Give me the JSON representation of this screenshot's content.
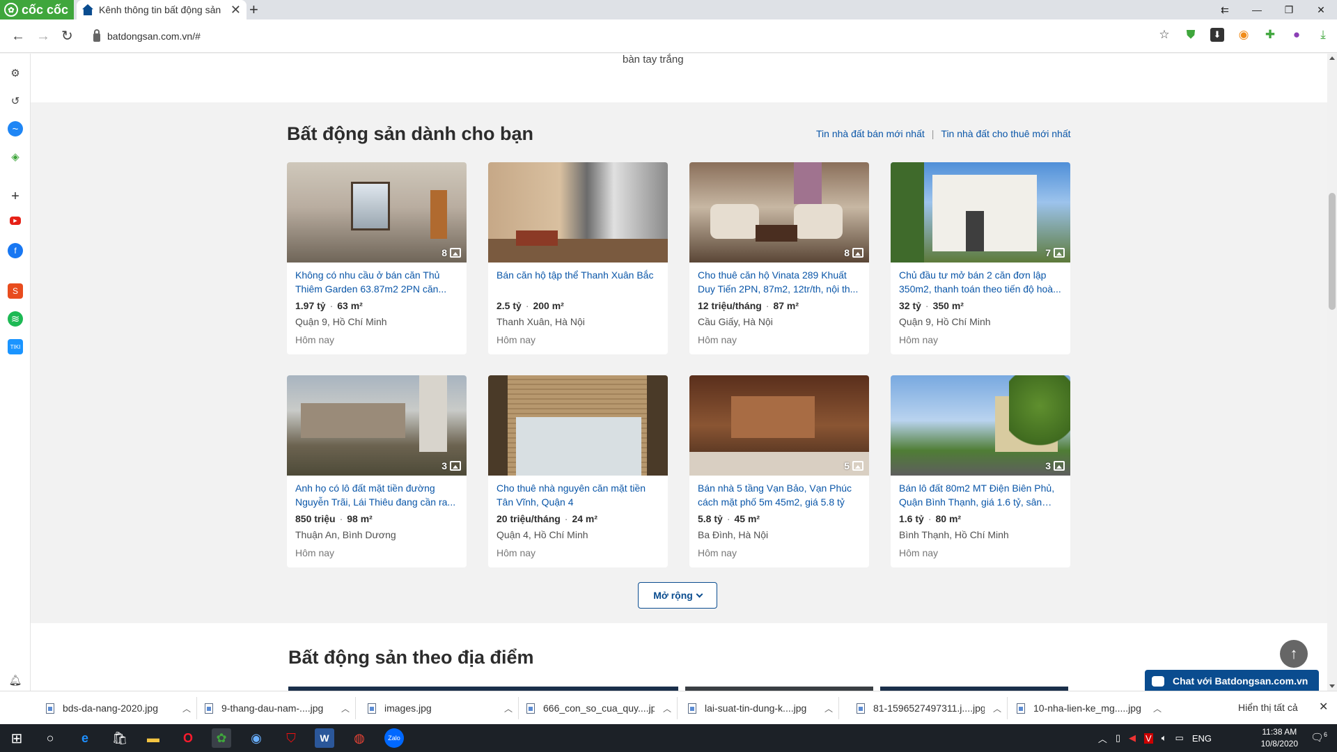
{
  "browser": {
    "logo_text": "cốc cốc",
    "tab_title": "Kênh thông tin bất động sản",
    "url": "batdongsan.com.vn/#"
  },
  "page": {
    "top_snippet": "bàn tay trắng",
    "section_title": "Bất động sản dành cho bạn",
    "link_sale": "Tin nhà đất bán mới nhất",
    "link_separator": "|",
    "link_rent": "Tin nhà đất cho thuê mới nhất",
    "expand_label": "Mở rộng",
    "section2_title": "Bất động sản theo địa điểm",
    "chat_label": "Chat với Batdongsan.com.vn"
  },
  "listings": [
    {
      "title": "Không có nhu cầu ở bán căn Thủ Thiêm Garden 63.87m2 2PN căn...",
      "price": "1.97 tỷ",
      "area": "63 m²",
      "location": "Quận 9, Hồ Chí Minh",
      "time": "Hôm nay",
      "photos": "8"
    },
    {
      "title": "Bán căn hộ tập thể Thanh Xuân Bắc",
      "price": "2.5 tỷ",
      "area": "200 m²",
      "location": "Thanh Xuân, Hà Nội",
      "time": "Hôm nay",
      "photos": ""
    },
    {
      "title": "Cho thuê căn hộ Vinata 289 Khuất Duy Tiến 2PN, 87m2, 12tr/th, nội th...",
      "price": "12 triệu/tháng",
      "area": "87 m²",
      "location": "Cầu Giấy, Hà Nội",
      "time": "Hôm nay",
      "photos": "8"
    },
    {
      "title": "Chủ đầu tư mở bán 2 căn đơn lập 350m2, thanh toán theo tiến độ hoà...",
      "price": "32 tỷ",
      "area": "350 m²",
      "location": "Quận 9, Hồ Chí Minh",
      "time": "Hôm nay",
      "photos": "7"
    },
    {
      "title": "Anh họ có lô đất mặt tiền đường Nguyễn Trãi, Lái Thiêu đang cần ra...",
      "price": "850 triệu",
      "area": "98 m²",
      "location": "Thuận An, Bình Dương",
      "time": "Hôm nay",
      "photos": "3"
    },
    {
      "title": "Cho thuê nhà nguyên căn mặt tiền Tân Vĩnh, Quận 4",
      "price": "20 triệu/tháng",
      "area": "24 m²",
      "location": "Quận 4, Hồ Chí Minh",
      "time": "Hôm nay",
      "photos": ""
    },
    {
      "title": "Bán nhà 5 tầng Vạn Bảo, Vạn Phúc cách mặt phố 5m 45m2, giá 5.8 tỷ",
      "price": "5.8 tỷ",
      "area": "45 m²",
      "location": "Ba Đình, Hà Nội",
      "time": "Hôm nay",
      "photos": "5"
    },
    {
      "title": "Bán lô đất 80m2 MT Điện Biên Phủ, Quận Bình Thạnh, giá 1.6 tỷ, sân cư...",
      "price": "1.6 tỷ",
      "area": "80 m²",
      "location": "Bình Thạnh, Hồ Chí Minh",
      "time": "Hôm nay",
      "photos": "3"
    }
  ],
  "downloads": [
    "bds-da-nang-2020.jpg",
    "9-thang-dau-nam-....jpg",
    "images.jpg",
    "666_con_so_cua_quy....jpg",
    "lai-suat-tin-dung-k....jpg",
    "81-1596527497311.j....jpg",
    "10-nha-lien-ke_mg.....jpg"
  ],
  "downloads_show_all": "Hiển thị tất cả",
  "taskbar": {
    "lang": "ENG",
    "time": "11:38 AM",
    "date": "10/8/2020",
    "notif_count": "6"
  },
  "colors": {
    "accent": "#0a56a8",
    "brand_dark": "#0a4c8f",
    "logo_green": "#3fa63c"
  }
}
